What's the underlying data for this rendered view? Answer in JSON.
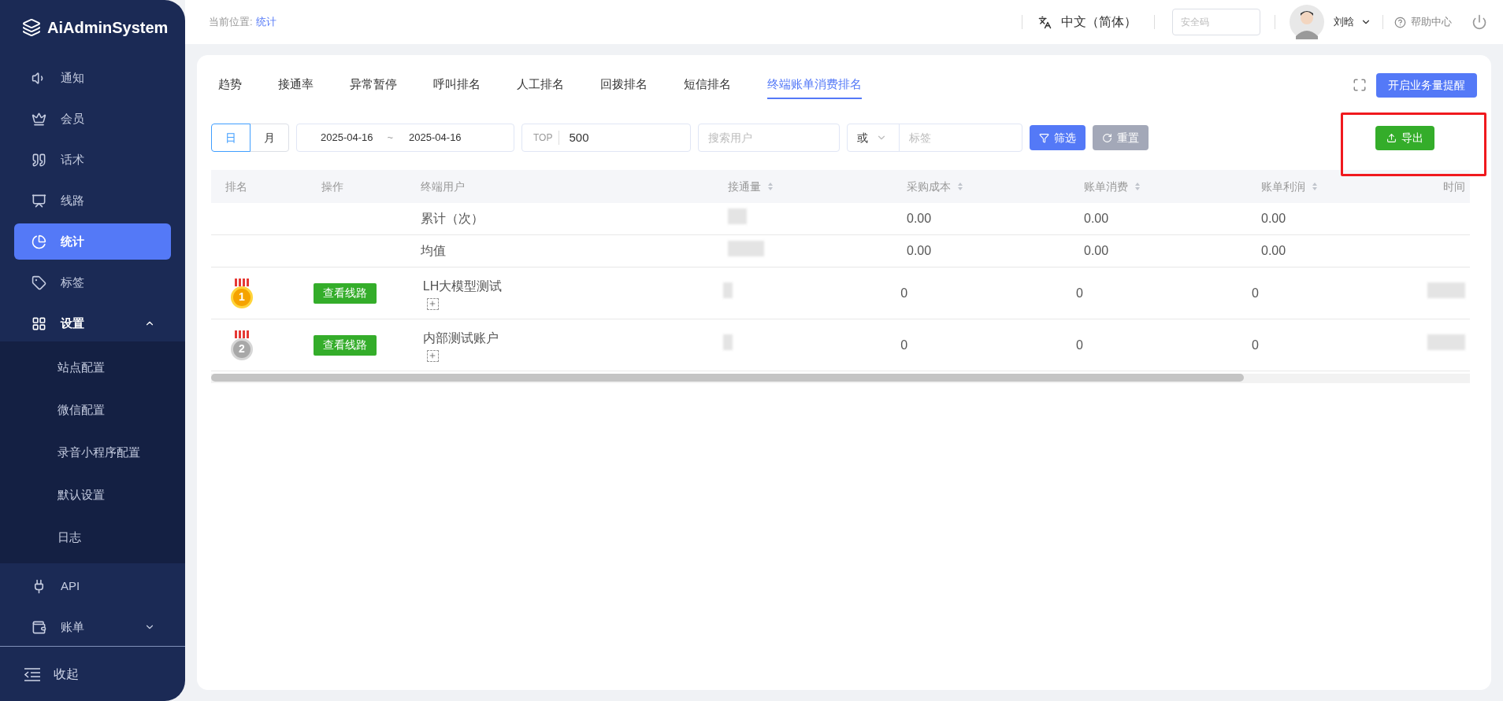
{
  "brand": "AiAdminSystem",
  "sidebar": {
    "items": [
      {
        "label": "通知",
        "selected": false
      },
      {
        "label": "会员",
        "selected": false
      },
      {
        "label": "话术",
        "selected": false
      },
      {
        "label": "线路",
        "selected": false
      },
      {
        "label": "统计",
        "selected": true
      },
      {
        "label": "标签",
        "selected": false
      },
      {
        "label": "设置",
        "selected": false,
        "expanded": true,
        "children": [
          {
            "label": "站点配置"
          },
          {
            "label": "微信配置"
          },
          {
            "label": "录音小程序配置"
          },
          {
            "label": "默认设置"
          },
          {
            "label": "日志"
          }
        ]
      },
      {
        "label": "API",
        "selected": false
      },
      {
        "label": "账单",
        "selected": false,
        "expanded": false
      }
    ],
    "collapse": "收起"
  },
  "topbar": {
    "breadcrumb_label": "当前位置:",
    "breadcrumb": "统计",
    "language": "中文（简体）",
    "security_placeholder": "安全码",
    "user": "刘晗",
    "help": "帮助中心"
  },
  "tabs": [
    {
      "label": "趋势",
      "selected": false
    },
    {
      "label": "接通率",
      "selected": false
    },
    {
      "label": "异常暂停",
      "selected": false
    },
    {
      "label": "呼叫排名",
      "selected": false
    },
    {
      "label": "人工排名",
      "selected": false
    },
    {
      "label": "回拨排名",
      "selected": false
    },
    {
      "label": "短信排名",
      "selected": false
    },
    {
      "label": "终端账单消费排名",
      "selected": true
    }
  ],
  "alert_button": "开启业务量提醒",
  "filters": {
    "period": [
      {
        "label": "日",
        "selected": true
      },
      {
        "label": "月",
        "selected": false
      }
    ],
    "date_from": "2025-04-16",
    "date_sep": "~",
    "date_to": "2025-04-16",
    "top_label": "TOP",
    "top_value": "500",
    "user_placeholder": "搜索用户",
    "logic": "或",
    "tag_placeholder": "标签",
    "filter_button": "筛选",
    "reset_button": "重置",
    "export_button": "导出",
    "export_highlighted": true
  },
  "table": {
    "columns": [
      {
        "label": "排名",
        "sortable": false
      },
      {
        "label": "操作",
        "sortable": false
      },
      {
        "label": "终端用户",
        "sortable": false
      },
      {
        "label": "接通量",
        "sortable": true
      },
      {
        "label": "采购成本",
        "sortable": true
      },
      {
        "label": "账单消费",
        "sortable": true
      },
      {
        "label": "账单利润",
        "sortable": true
      },
      {
        "label": "时间",
        "sortable": false
      }
    ],
    "rows": [
      {
        "kind": "summary",
        "user": "累计（次）",
        "connected_blurred": true,
        "cost": "0.00",
        "spend": "0.00",
        "profit": "0.00"
      },
      {
        "kind": "summary",
        "user": "均值",
        "connected_blurred": true,
        "cost": "0.00",
        "spend": "0.00",
        "profit": "0.00"
      },
      {
        "kind": "ranked",
        "rank": "1",
        "action": "查看线路",
        "user": "LH大模型测试",
        "expandable": true,
        "connected_blurred": true,
        "cost": "0",
        "spend": "0",
        "profit": "0",
        "time_blurred": true
      },
      {
        "kind": "ranked",
        "rank": "2",
        "action": "查看线路",
        "user": "内部测试账户",
        "expandable": true,
        "connected_blurred": true,
        "cost": "0",
        "spend": "0",
        "profit": "0",
        "time_blurred": true
      }
    ]
  }
}
